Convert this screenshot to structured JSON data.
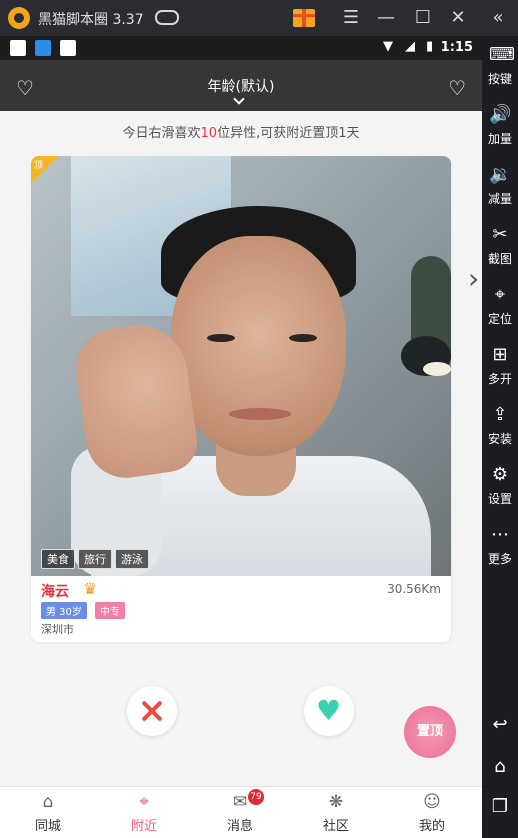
{
  "emulator": {
    "title": "黑猫脚本圈 3.37",
    "window_buttons": [
      "menu-icon",
      "minimize-icon",
      "maximize-icon",
      "close-icon"
    ],
    "sidebar": [
      {
        "icon": "keyboard-icon",
        "label": "按键"
      },
      {
        "icon": "volume-up-icon",
        "label": "加量"
      },
      {
        "icon": "volume-down-icon",
        "label": "减量"
      },
      {
        "icon": "scissors-icon",
        "label": "截图"
      },
      {
        "icon": "location-icon",
        "label": "定位"
      },
      {
        "icon": "multi-open-icon",
        "label": "多开"
      },
      {
        "icon": "apk-icon",
        "label": "安装"
      },
      {
        "icon": "settings-icon",
        "label": "设置"
      },
      {
        "icon": "more-icon",
        "label": "更多"
      }
    ]
  },
  "statusbar": {
    "time": "1:15"
  },
  "appbar": {
    "title": "年龄(默认)"
  },
  "notice": {
    "prefix": "今日右滑喜欢",
    "count": "10",
    "suffix": "位异性,可获附近置顶1天"
  },
  "card": {
    "corner_label": "顶",
    "tags": [
      "美食",
      "旅行",
      "游泳"
    ],
    "name": "海云",
    "distance": "30.56Km",
    "gender_age": "男 30岁",
    "education": "中专",
    "city": "深圳市"
  },
  "promo": {
    "label": "置顶"
  },
  "bottom_nav": {
    "items": [
      {
        "icon": "home-icon",
        "label": "同城"
      },
      {
        "icon": "location-pin-icon",
        "label": "附近"
      },
      {
        "icon": "message-icon",
        "label": "消息",
        "badge": "79"
      },
      {
        "icon": "community-icon",
        "label": "社区"
      },
      {
        "icon": "profile-icon",
        "label": "我的"
      }
    ],
    "active_index": 1
  },
  "colors": {
    "accent": "#f25a7b",
    "like": "#39d1b0",
    "dislike": "#ea4b3f",
    "highlight": "#e8373e"
  }
}
